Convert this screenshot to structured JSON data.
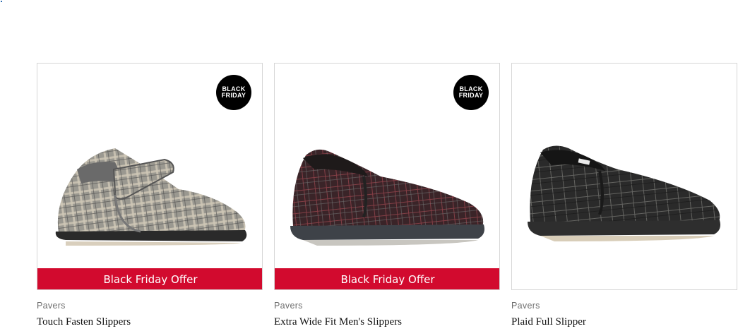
{
  "products": [
    {
      "brand": "Pavers",
      "name": "Touch Fasten Slippers",
      "badge_line1": "BLACK",
      "badge_line2": "FRIDAY",
      "offer": "Black Friday Offer"
    },
    {
      "brand": "Pavers",
      "name": "Extra Wide Fit Men's Slippers",
      "badge_line1": "BLACK",
      "badge_line2": "FRIDAY",
      "offer": "Black Friday Offer"
    },
    {
      "brand": "Pavers",
      "name": "Plaid Full Slipper"
    }
  ],
  "colors": {
    "offer_bar": "#d20a2e",
    "badge": "#000000",
    "card_border": "#d6d6d6"
  },
  "icons": [
    "grey-check-touch-fasten-slipper-image",
    "burgundy-check-slipper-image",
    "charcoal-plaid-slipper-image"
  ]
}
